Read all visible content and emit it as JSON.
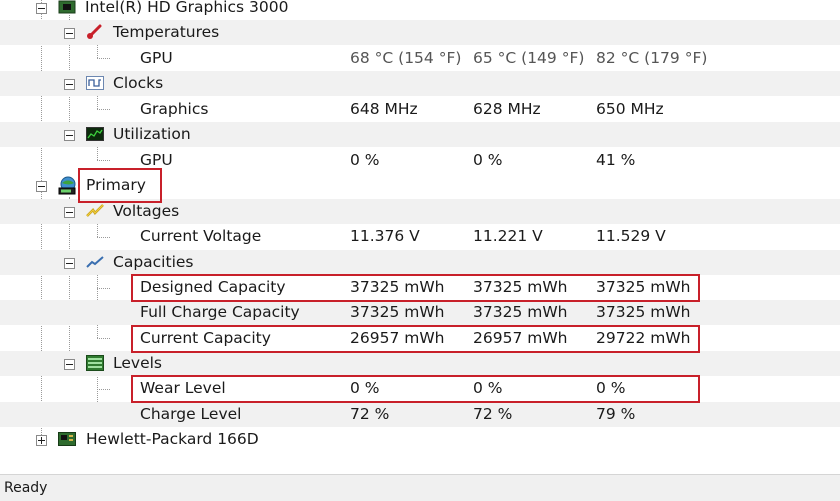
{
  "tree": {
    "gpu_node": {
      "label": "Intel(R) HD Graphics 3000"
    },
    "temperatures": {
      "label": "Temperatures"
    },
    "gpu_temp": {
      "label": "GPU",
      "values": [
        "68 °C  (154 °F)",
        "65 °C  (149 °F)",
        "82 °C  (179 °F)"
      ]
    },
    "clocks": {
      "label": "Clocks"
    },
    "graphics_clock": {
      "label": "Graphics",
      "values": [
        "648 MHz",
        "628 MHz",
        "650 MHz"
      ]
    },
    "utilization": {
      "label": "Utilization"
    },
    "gpu_util": {
      "label": "GPU",
      "values": [
        "0 %",
        "0 %",
        "41 %"
      ]
    },
    "primary": {
      "label": "Primary"
    },
    "voltages": {
      "label": "Voltages"
    },
    "current_voltage": {
      "label": "Current Voltage",
      "values": [
        "11.376 V",
        "11.221 V",
        "11.529 V"
      ]
    },
    "capacities": {
      "label": "Capacities"
    },
    "designed_capacity": {
      "label": "Designed Capacity",
      "values": [
        "37325 mWh",
        "37325 mWh",
        "37325 mWh"
      ]
    },
    "full_charge_capacity": {
      "label": "Full Charge Capacity",
      "values": [
        "37325 mWh",
        "37325 mWh",
        "37325 mWh"
      ]
    },
    "current_capacity": {
      "label": "Current Capacity",
      "values": [
        "26957 mWh",
        "26957 mWh",
        "29722 mWh"
      ]
    },
    "levels": {
      "label": "Levels"
    },
    "wear_level": {
      "label": "Wear Level",
      "values": [
        "0 %",
        "0 %",
        "0 %"
      ]
    },
    "charge_level": {
      "label": "Charge Level",
      "values": [
        "72 %",
        "72 %",
        "79 %"
      ]
    },
    "hp_node": {
      "label": "Hewlett-Packard 166D"
    }
  },
  "statusbar": {
    "text": "Ready"
  },
  "colors": {
    "highlight": "#c8202a",
    "row_alt": "#f1f1f1"
  },
  "icons": [
    "gpu-chip-icon",
    "thermometer-icon",
    "clock-wave-icon",
    "utilization-graph-icon",
    "battery-globe-icon",
    "voltage-bolt-icon",
    "capacity-line-icon",
    "levels-bars-icon",
    "motherboard-icon"
  ]
}
